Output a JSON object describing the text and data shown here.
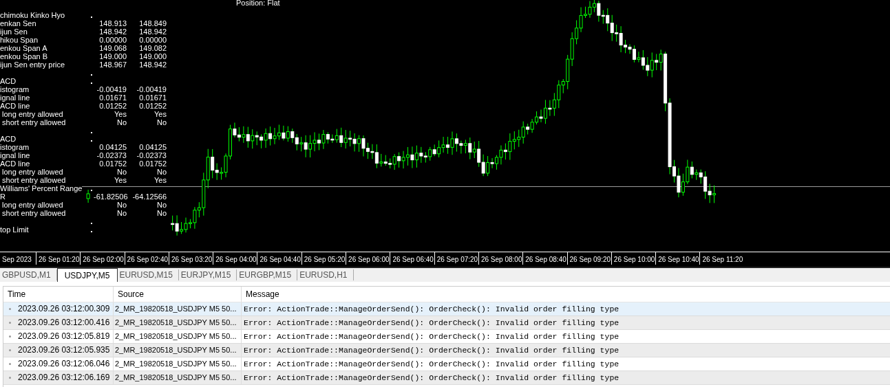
{
  "chart": {
    "position_label": "Position: Flat",
    "indicator_panel": {
      "rows": [
        {
          "kind": "header",
          "label": "chimoku Kinko Hyo"
        },
        {
          "kind": "value",
          "label": "enkan Sen",
          "value_1": "148.913",
          "value_2": "148.849"
        },
        {
          "kind": "value",
          "label": "ijun Sen",
          "value_1": "148.942",
          "value_2": "148.942"
        },
        {
          "kind": "value",
          "label": "hikou Span",
          "value_1": "0.00000",
          "value_2": "0.00000"
        },
        {
          "kind": "value",
          "label": "enkou Span A",
          "value_1": "149.068",
          "value_2": "149.082"
        },
        {
          "kind": "value",
          "label": "enkou Span B",
          "value_1": "149.000",
          "value_2": "149.000"
        },
        {
          "kind": "value",
          "label": "ijun Sen entry price",
          "value_1": "148.967",
          "value_2": "148.942"
        },
        {
          "kind": "gap"
        },
        {
          "kind": "header",
          "label": "ACD"
        },
        {
          "kind": "value",
          "label": "istogram",
          "value_1": "-0.00419",
          "value_2": "-0.00419"
        },
        {
          "kind": "value",
          "label": "ignal line",
          "value_1": "0.01671",
          "value_2": "0.01671"
        },
        {
          "kind": "value",
          "label": "ACD line",
          "value_1": "0.01252",
          "value_2": "0.01252"
        },
        {
          "kind": "value",
          "label": " long entry allowed",
          "value_1": "Yes",
          "value_2": "Yes"
        },
        {
          "kind": "value",
          "label": " short entry allowed",
          "value_1": "No",
          "value_2": "No"
        },
        {
          "kind": "gap"
        },
        {
          "kind": "header",
          "label": "ACD"
        },
        {
          "kind": "value",
          "label": "istogram",
          "value_1": "0.04125",
          "value_2": "0.04125"
        },
        {
          "kind": "value",
          "label": "ignal line",
          "value_1": "-0.02373",
          "value_2": "-0.02373"
        },
        {
          "kind": "value",
          "label": "ACD line",
          "value_1": "0.01752",
          "value_2": "0.01752"
        },
        {
          "kind": "value",
          "label": " long entry allowed",
          "value_1": "No",
          "value_2": "No"
        },
        {
          "kind": "value",
          "label": " short entry allowed",
          "value_1": "Yes",
          "value_2": "Yes"
        },
        {
          "kind": "header",
          "label": "Williams' Percent Range"
        },
        {
          "kind": "value",
          "label": "R",
          "value_1": "-61.82506",
          "value_2": "-64.12566"
        },
        {
          "kind": "value",
          "label": " long entry allowed",
          "value_1": "No",
          "value_2": "No"
        },
        {
          "kind": "value",
          "label": " short entry allowed",
          "value_1": "No",
          "value_2": "No"
        },
        {
          "kind": "gap"
        },
        {
          "kind": "header",
          "label": "top Limit"
        }
      ]
    }
  },
  "time_axis": {
    "labels": [
      "Sep 2023",
      "26 Sep 01:20",
      "26 Sep 02:00",
      "26 Sep 02:40",
      "26 Sep 03:20",
      "26 Sep 04:00",
      "26 Sep 04:40",
      "26 Sep 05:20",
      "26 Sep 06:00",
      "26 Sep 06:40",
      "26 Sep 07:20",
      "26 Sep 08:00",
      "26 Sep 08:40",
      "26 Sep 09:20",
      "26 Sep 10:00",
      "26 Sep 10:40",
      "26 Sep 11:20"
    ]
  },
  "tabs": [
    {
      "label": "GBPUSD,M1",
      "selected": false
    },
    {
      "label": "USDJPY,M5",
      "selected": true
    },
    {
      "label": "EURUSD,M15",
      "selected": false
    },
    {
      "label": "EURJPY,M15",
      "selected": false
    },
    {
      "label": "EURGBP,M15",
      "selected": false
    },
    {
      "label": "EURUSD,H1",
      "selected": false
    }
  ],
  "log": {
    "columns": [
      "Time",
      "Source",
      "Message"
    ],
    "rows": [
      {
        "time": "2023.09.26 03:12:00.309",
        "source": "2_MR_19820518_USDJPY M5 50...",
        "message": "Error: ActionTrade::ManageOrderSend(): OrderCheck(): Invalid order filling type",
        "selected": true
      },
      {
        "time": "2023.09.26 03:12:00.416",
        "source": "2_MR_19820518_USDJPY M5 50...",
        "message": "Error: ActionTrade::ManageOrderSend(): OrderCheck(): Invalid order filling type",
        "selected": false
      },
      {
        "time": "2023.09.26 03:12:05.819",
        "source": "2_MR_19820518_USDJPY M5 50...",
        "message": "Error: ActionTrade::ManageOrderSend(): OrderCheck(): Invalid order filling type",
        "selected": false
      },
      {
        "time": "2023.09.26 03:12:05.935",
        "source": "2_MR_19820518_USDJPY M5 50...",
        "message": "Error: ActionTrade::ManageOrderSend(): OrderCheck(): Invalid order filling type",
        "selected": false
      },
      {
        "time": "2023.09.26 03:12:06.046",
        "source": "2_MR_19820518_USDJPY M5 50...",
        "message": "Error: ActionTrade::ManageOrderSend(): OrderCheck(): Invalid order filling type",
        "selected": false
      },
      {
        "time": "2023.09.26 03:12:06.169",
        "source": "2_MR_19820518_USDJPY M5 50...",
        "message": "Error: ActionTrade::ManageOrderSend(): OrderCheck(): Invalid order filling type",
        "selected": false
      }
    ]
  }
}
